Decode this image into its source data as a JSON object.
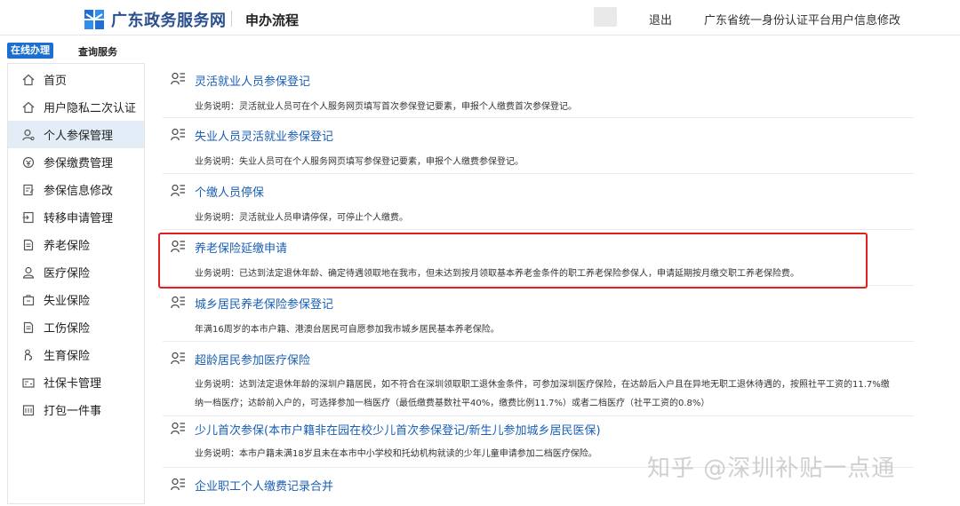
{
  "header": {
    "logo_text": "广东政务服务网",
    "page_title": "申办流程",
    "logout": "退出",
    "edit_info": "广东省统一身份认证平台用户信息修改"
  },
  "tabs": {
    "online": "在线办理",
    "query": "查询服务"
  },
  "sidebar": {
    "items": [
      {
        "label": "首页",
        "icon": "home-icon"
      },
      {
        "label": "用户隐私二次认证",
        "icon": "home-icon"
      },
      {
        "label": "个人参保管理",
        "icon": "user-icon",
        "active": true
      },
      {
        "label": "参保缴费管理",
        "icon": "payment-icon"
      },
      {
        "label": "参保信息修改",
        "icon": "edit-icon"
      },
      {
        "label": "转移申请管理",
        "icon": "transfer-icon"
      },
      {
        "label": "养老保险",
        "icon": "document-icon"
      },
      {
        "label": "医疗保险",
        "icon": "medical-icon"
      },
      {
        "label": "失业保险",
        "icon": "briefcase-icon"
      },
      {
        "label": "工伤保险",
        "icon": "document-icon"
      },
      {
        "label": "生育保险",
        "icon": "maternity-icon"
      },
      {
        "label": "社保卡管理",
        "icon": "card-icon"
      },
      {
        "label": "打包一件事",
        "icon": "package-icon"
      }
    ]
  },
  "services": [
    {
      "title": "灵活就业人员参保登记",
      "desc": "业务说明：灵活就业人员可在个人服务网页填写首次参保登记要素，申报个人缴费首次参保登记。"
    },
    {
      "title": "失业人员灵活就业参保登记",
      "desc": "业务说明：失业人员可在个人服务网页填写参保登记要素，申报个人缴费参保登记。"
    },
    {
      "title": "个缴人员停保",
      "desc": "业务说明：灵活就业人员申请停保，可停止个人缴费。"
    },
    {
      "title": "养老保险延缴申请",
      "desc": "业务说明：已达到法定退休年龄、确定待遇领取地在我市，但未达到按月领取基本养老金条件的职工养老保险参保人，申请延期按月缴交职工养老保险费。"
    },
    {
      "title": "城乡居民养老保险参保登记",
      "desc": "年满16周岁的本市户籍、港澳台居民可自愿参加我市城乡居民基本养老保险。"
    },
    {
      "title": "超龄居民参加医疗保险",
      "desc": "业务说明：达到法定退休年龄的深圳户籍居民，如不符合在深圳领取职工退休金条件，可参加深圳医疗保险，在达龄后入户且在异地无职工退休待遇的，按照社平工资的11.7%缴纳一档医疗；达龄前入户的，可选择参加一档医疗（最低缴费基数社平40%，缴费比例11.7%）或者二档医疗（社平工资的0.8%）"
    },
    {
      "title": "少儿首次参保(本市户籍非在园在校少儿首次参保登记/新生儿参加城乡居民医保)",
      "desc": "业务说明：本市户籍未满18岁且未在本市中小学校和托幼机构就读的少年儿童申请参加二档医疗保险。"
    },
    {
      "title": "企业职工个人缴费记录合并",
      "desc": ""
    }
  ],
  "watermark": "知乎 @深圳补贴一点通",
  "colors": {
    "accent": "#1c6fd0",
    "link": "#1a5fb4",
    "highlight_border": "#e02020",
    "active_bg": "#e3edf8"
  }
}
